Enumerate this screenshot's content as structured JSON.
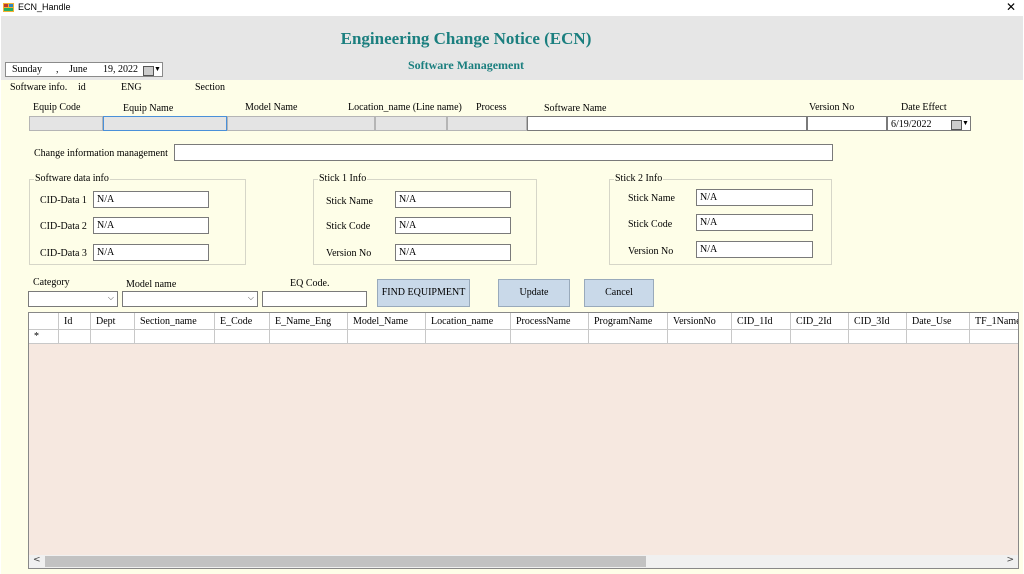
{
  "window": {
    "title": "ECN_Handle",
    "close_glyph": "✕"
  },
  "header": {
    "title": "Engineering Change Notice (ECN)",
    "subtitle": "Software Management"
  },
  "date_picker": {
    "weekday": "Sunday",
    "sep": ",",
    "month": "June",
    "day_year": "19, 2022"
  },
  "info_row": {
    "software_info": "Software info.",
    "id": "id",
    "eng": "ENG",
    "section": "Section"
  },
  "equip_headers": {
    "equip_code": "Equip Code",
    "equip_name": "Equip Name",
    "model_name": "Model Name",
    "location_name": "Location_name (Line name)",
    "process": "Process",
    "software_name": "Software Name",
    "version_no": "Version No",
    "date_effect": "Date Effect"
  },
  "date_effect_value": "6/19/2022",
  "change_info_label": "Change information management",
  "software_data": {
    "legend": "Software data info",
    "rows": [
      {
        "label": "CID-Data 1",
        "value": "N/A"
      },
      {
        "label": "CID-Data 2",
        "value": "N/A"
      },
      {
        "label": "CID-Data 3",
        "value": "N/A"
      }
    ]
  },
  "stick1": {
    "legend": "Stick 1 Info",
    "rows": [
      {
        "label": "Stick Name",
        "value": "N/A"
      },
      {
        "label": "Stick Code",
        "value": "N/A"
      },
      {
        "label": "Version No",
        "value": "N/A"
      }
    ]
  },
  "stick2": {
    "legend": "Stick 2 Info",
    "rows": [
      {
        "label": "Stick Name",
        "value": "N/A"
      },
      {
        "label": "Stick Code",
        "value": "N/A"
      },
      {
        "label": "Version No",
        "value": "N/A"
      }
    ]
  },
  "filters": {
    "category": "Category",
    "model_name": "Model name",
    "eq_code": "EQ Code."
  },
  "buttons": {
    "find": "FIND EQUIPMENT",
    "update": "Update",
    "cancel": "Cancel"
  },
  "grid": {
    "columns": [
      "Id",
      "Dept",
      "Section_name",
      "E_Code",
      "E_Name_Eng",
      "Model_Name",
      "Location_name",
      "ProcessName",
      "ProgramName",
      "VersionNo",
      "CID_1Id",
      "CID_2Id",
      "CID_3Id",
      "Date_Use",
      "TF_1Name"
    ],
    "new_row_marker": "*"
  },
  "scrollbar": {
    "left_arrow": "<",
    "right_arrow": ">"
  },
  "colors": {
    "title_teal": "#1b7f7f",
    "form_bg": "#fefee8",
    "grid_bg": "#f6e8e0",
    "button_bg": "#c9d9e9"
  }
}
